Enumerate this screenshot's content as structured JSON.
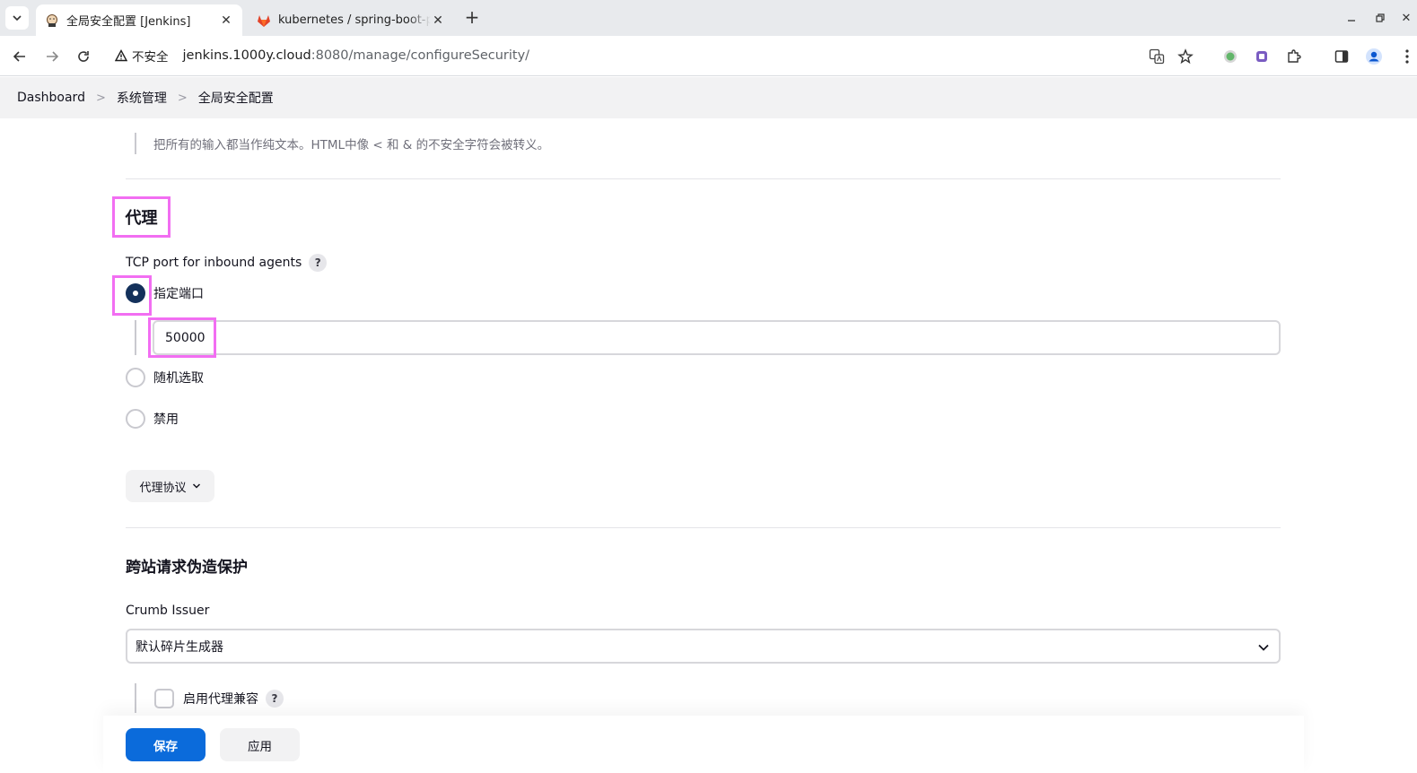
{
  "browser": {
    "tabs": [
      {
        "title": "全局安全配置 [Jenkins]",
        "icon": "jenkins-icon",
        "active": true
      },
      {
        "title": "kubernetes / spring-boot-p",
        "icon": "gitlab-icon",
        "active": false
      }
    ],
    "security_chip": "不安全",
    "url_host": "jenkins.1000y.cloud",
    "url_rest": ":8080/manage/configureSecurity/"
  },
  "breadcrumbs": [
    "Dashboard",
    "系统管理",
    "全局安全配置"
  ],
  "markup_hint": "把所有的输入都当作纯文本。HTML中像 < 和 & 的不安全字符会被转义。",
  "agents": {
    "title": "代理",
    "tcp_port_label": "TCP port for inbound agents",
    "help": "?",
    "options": [
      {
        "label": "指定端口",
        "selected": true
      },
      {
        "label": "随机选取",
        "selected": false
      },
      {
        "label": "禁用",
        "selected": false
      }
    ],
    "port_value": "50000",
    "protocols_button": "代理协议"
  },
  "csrf": {
    "title": "跨站请求伪造保护",
    "crumb_issuer_label": "Crumb Issuer",
    "crumb_issuer_value": "默认碎片生成器",
    "proxy_compat_label": "启用代理兼容",
    "help": "?"
  },
  "actions": {
    "save": "保存",
    "apply": "应用"
  },
  "colors": {
    "highlight": "#f26ef2",
    "primary": "#0b6bdb",
    "radio_on": "#14315b"
  }
}
